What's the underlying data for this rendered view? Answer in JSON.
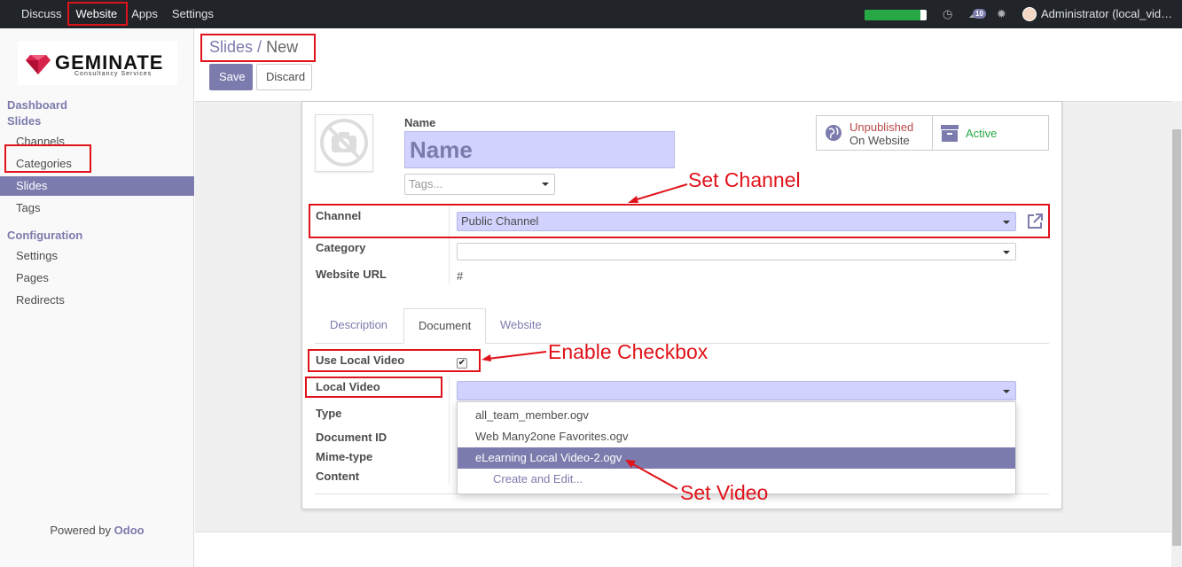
{
  "topbar": {
    "menu": [
      "Discuss",
      "Website",
      "Apps",
      "Settings"
    ],
    "active": "Website",
    "progress": 0.9,
    "messages_count": "10",
    "user": "Administrator (local_vid…"
  },
  "logo": {
    "brand": "GEMINATE",
    "tagline": "Consultancy Services"
  },
  "sidebar": {
    "dashboard": "Dashboard",
    "slides_head": "Slides",
    "items": [
      "Channels",
      "Categories",
      "Slides",
      "Tags"
    ],
    "config_head": "Configuration",
    "config_items": [
      "Settings",
      "Pages",
      "Redirects"
    ],
    "powered_prefix": "Powered by ",
    "powered_brand": "Odoo"
  },
  "breadcrumb": {
    "parent": "Slides",
    "sep": "/",
    "current": "New"
  },
  "buttons": {
    "save": "Save",
    "discard": "Discard"
  },
  "form": {
    "name_label": "Name",
    "name_placeholder": "Name",
    "tags_placeholder": "Tags...",
    "stat_published_1": "Unpublished",
    "stat_published_2": "On Website",
    "stat_active": "Active",
    "channel_label": "Channel",
    "channel_value": "Public Channel",
    "category_label": "Category",
    "category_value": "",
    "url_label": "Website URL",
    "url_value": "#",
    "tabs": [
      "Description",
      "Document",
      "Website"
    ],
    "use_local_label": "Use Local Video",
    "use_local_checked": true,
    "local_video_label": "Local Video",
    "type_label": "Type",
    "docid_label": "Document ID",
    "mime_label": "Mime-type",
    "content_label": "Content",
    "dropdown": [
      "all_team_member.ogv",
      "Web Many2one Favorites.ogv",
      "eLearning Local Video-2.ogv"
    ],
    "dropdown_create": "Create and Edit..."
  },
  "annotations": {
    "set_channel": "Set Channel",
    "enable_checkbox": "Enable Checkbox",
    "set_video": "Set Video"
  },
  "colors": {
    "primary": "#7c7bad",
    "annotation": "#e0131a",
    "required_bg": "#d2d2ff"
  }
}
